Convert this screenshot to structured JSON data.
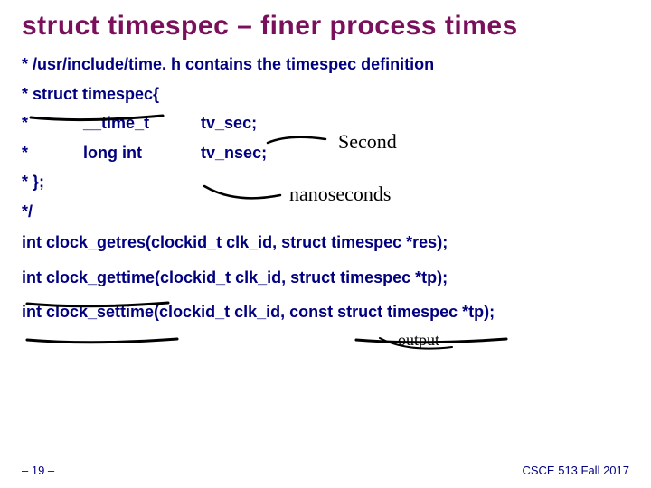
{
  "title": "struct timespec – finer process times",
  "lines": {
    "l1": "* /usr/include/time. h contains the timespec definition",
    "l2": "* struct timespec{",
    "l3a": "*",
    "l3b": "__time_t",
    "l3c": "tv_sec;",
    "l4a": "*",
    "l4b": "long int",
    "l4c": "tv_nsec;",
    "l5": "*  };",
    "l6": "*/",
    "f1": "int clock_getres(clockid_t clk_id, struct timespec *res);",
    "f2": "int clock_gettime(clockid_t clk_id, struct timespec *tp);",
    "f3": "int clock_settime(clockid_t clk_id, const struct timespec *tp);"
  },
  "footer": {
    "left": "– 19 –",
    "right": "CSCE 513 Fall 2017"
  },
  "annotations": {
    "a1": "Second",
    "a2": "nanoseconds",
    "a3": "output"
  }
}
